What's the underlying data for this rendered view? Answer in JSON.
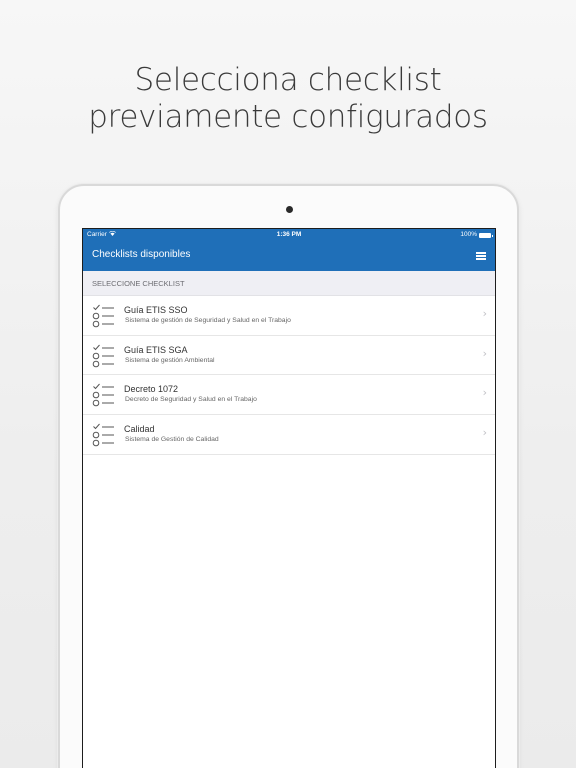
{
  "headline": {
    "line1": "Selecciona checklist",
    "line2": "previamente configurados"
  },
  "status_bar": {
    "carrier": "Carrier",
    "wifi_icon": "wifi-icon",
    "time": "1:36 PM",
    "battery": "100%"
  },
  "navbar": {
    "title": "Checklists disponibles",
    "menu_icon": "hamburger-menu-icon"
  },
  "section": {
    "header": "SELECCIONE CHECKLIST"
  },
  "items": [
    {
      "name": "Guía ETIS SSO",
      "description": "Sistema de gestión de Seguridad y Salud en el Trabajo",
      "icon": "checklist-icon"
    },
    {
      "name": "Guía ETIS SGA",
      "description": "Sistema de gestión Ambiental",
      "icon": "checklist-icon"
    },
    {
      "name": "Decreto 1072",
      "description": "Decreto de Seguridad y Salud en el Trabajo",
      "icon": "checklist-icon"
    },
    {
      "name": "Calidad",
      "description": "Sistema de Gestión de Calidad",
      "icon": "checklist-icon"
    }
  ],
  "colors": {
    "brand_blue": "#1f6fb8",
    "section_bg": "#efeff4"
  }
}
